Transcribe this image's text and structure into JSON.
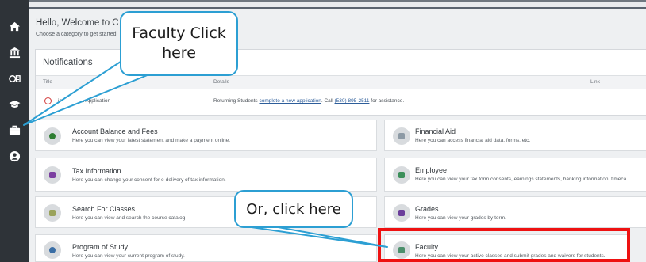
{
  "header": {
    "welcome": "Hello, Welcome to C",
    "subtitle": "Choose a category to get started."
  },
  "sidebar": {
    "items": [
      {
        "icon": "home-icon"
      },
      {
        "icon": "bank-icon"
      },
      {
        "icon": "id-card-icon"
      },
      {
        "icon": "graduation-cap-icon"
      },
      {
        "icon": "briefcase-icon"
      },
      {
        "icon": "user-icon"
      }
    ]
  },
  "notifications": {
    "title": "Notifications",
    "columns": [
      "Title",
      "Details",
      "Link"
    ],
    "row": {
      "title": "ing Student Application",
      "details_before": "Returning Students ",
      "details_link": "complete a new application",
      "details_mid": ". Call ",
      "details_phone": "(530) 895-2511",
      "details_after": " for assistance."
    }
  },
  "categories": [
    {
      "title": "Account Balance and Fees",
      "desc": "Here you can view your latest statement and make a payment online.",
      "icon": "money-icon",
      "color": "#2e7d32"
    },
    {
      "title": "Financial Aid",
      "desc": "Here you can access financial aid data, forms, etc.",
      "icon": "financial-aid-icon",
      "color": "#8d9aa5"
    },
    {
      "title": "Tax Information",
      "desc": "Here you can change your consent for e-delivery of tax information.",
      "icon": "tax-form-icon",
      "color": "#7b3fa0"
    },
    {
      "title": "Employee",
      "desc": "Here you can view your tax form consents, earnings statements, banking information, timeca",
      "icon": "employee-icon",
      "color": "#3c8f5a"
    },
    {
      "title": "Search For Classes",
      "desc": "Here you can view and search the course catalog.",
      "icon": "catalog-icon",
      "color": "#9aa35c"
    },
    {
      "title": "Grades",
      "desc": "Here you can view your grades by term.",
      "icon": "grades-icon",
      "color": "#6a3d9a"
    },
    {
      "title": "Program of Study",
      "desc": "Here you can view your current program of study.",
      "icon": "program-icon",
      "color": "#3a6ea5"
    },
    {
      "title": "Faculty",
      "desc": "Here you can view your active classes and submit grades and waivers for students.",
      "icon": "faculty-icon",
      "color": "#4b8f6b"
    }
  ],
  "callouts": {
    "faculty_line1": "Faculty Click",
    "faculty_line2": "here",
    "or_text": "Or, click here"
  },
  "colors": {
    "sidebar": "#2e3338",
    "callout_border": "#2c9fd3",
    "highlight": "#ee1111"
  }
}
